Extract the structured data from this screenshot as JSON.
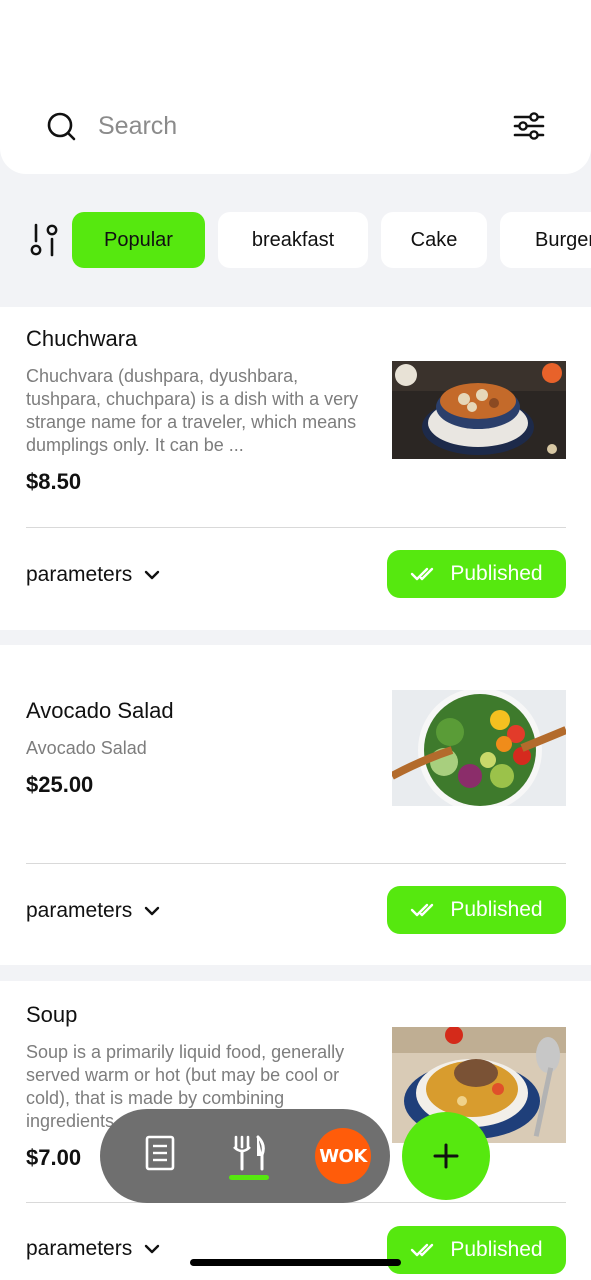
{
  "search": {
    "placeholder": "Search"
  },
  "categories": [
    "Popular",
    "breakfast",
    "Cake",
    "Burger"
  ],
  "items": [
    {
      "title": "Chuchwara",
      "description": "Chuchvara (dushpara, dyushbara, tushpara, chuchpara) is a dish with a very strange name for a traveler, which means dumplings only. It can be ...",
      "price": "$8.50",
      "params_label": "parameters",
      "status": "Published"
    },
    {
      "title": "Avocado Salad",
      "description": "Avocado Salad",
      "price": "$25.00",
      "params_label": "parameters",
      "status": "Published"
    },
    {
      "title": "Soup",
      "description": "Soup is a primarily liquid food, generally served warm or hot (but may be cool or cold), that is made by combining ingredients ...",
      "price": "$7.00",
      "params_label": "parameters",
      "status": "Published"
    }
  ],
  "bottom_nav": {
    "logo_text": "WOK"
  },
  "colors": {
    "accent": "#56e80f",
    "logo": "#ff5c0a",
    "nav": "#6f6f6f"
  }
}
